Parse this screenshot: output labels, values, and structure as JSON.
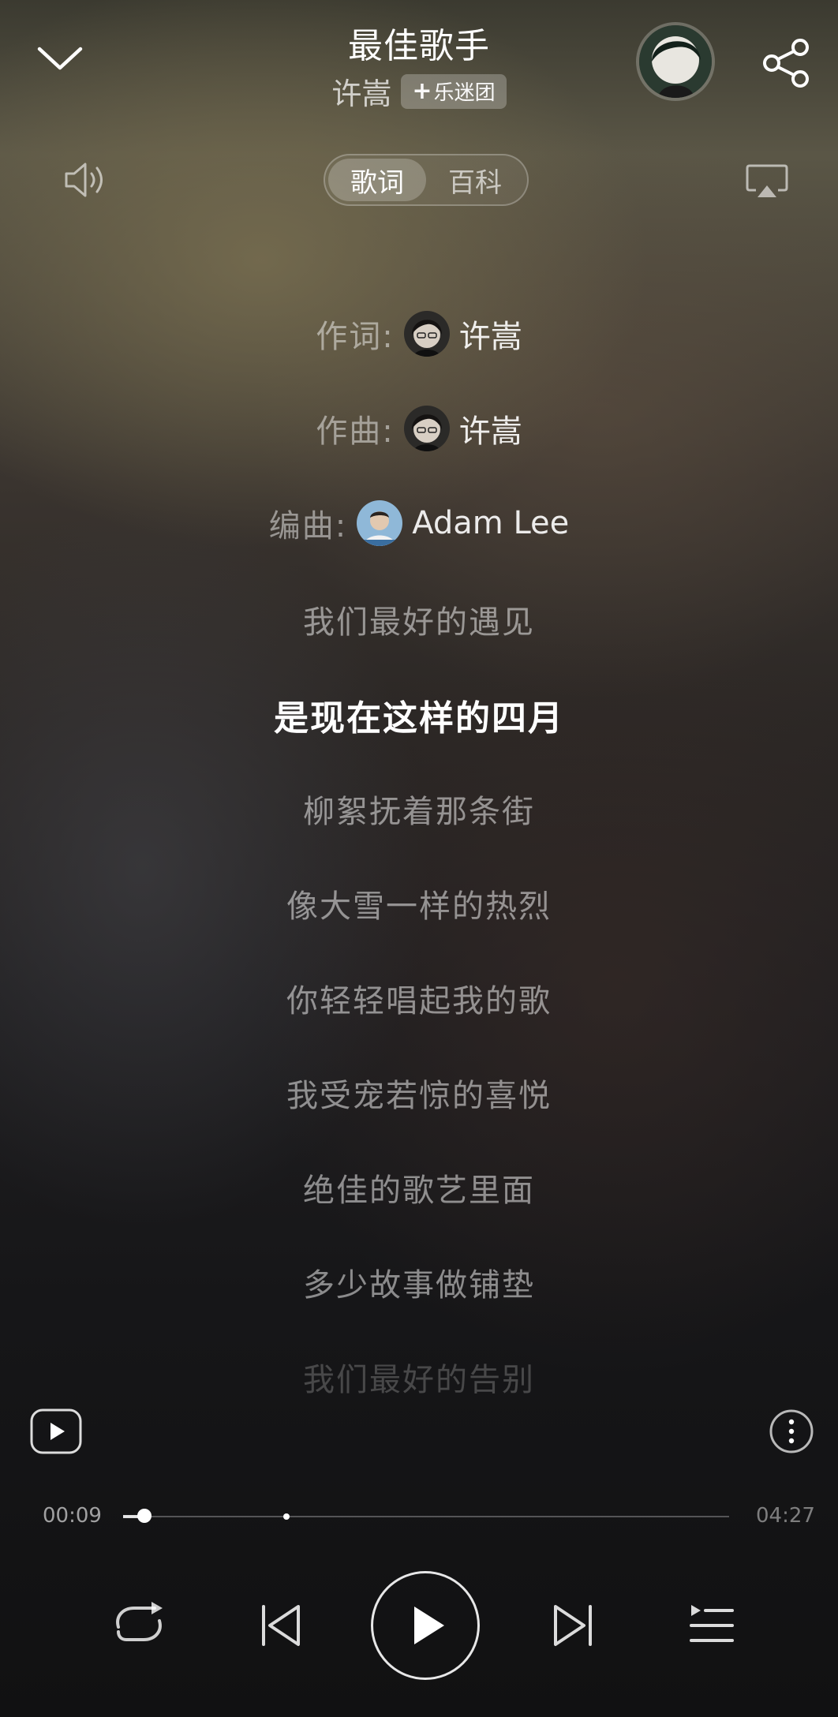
{
  "header": {
    "song_title": "最佳歌手",
    "artist": "许嵩",
    "fan_club_label": "乐迷团",
    "fan_club_prefix": "+"
  },
  "tabs": [
    {
      "label": "歌词",
      "active": true
    },
    {
      "label": "百科",
      "active": false
    }
  ],
  "credits": [
    {
      "label": "作词:",
      "name": "许嵩"
    },
    {
      "label": "作曲:",
      "name": "许嵩"
    },
    {
      "label": "编曲:",
      "name": "Adam Lee"
    }
  ],
  "lyrics": [
    "我们最好的遇见",
    "是现在这样的四月",
    "柳絮抚着那条街",
    "像大雪一样的热烈",
    "你轻轻唱起我的歌",
    "我受宠若惊的喜悦",
    "绝佳的歌艺里面",
    "多少故事做铺垫",
    "我们最好的告别"
  ],
  "current_lyric_index": 1,
  "player": {
    "current_time": "00:09",
    "total_time": "04:27",
    "progress_fraction": 0.035,
    "buffer_fraction": 0.27,
    "state": "paused"
  },
  "icons": {
    "collapse": "chevron-down-icon",
    "share": "share-icon",
    "volume": "volume-icon",
    "cast": "airplay-icon",
    "mv": "mv-play-icon",
    "more": "more-vertical-icon",
    "repeat": "repeat-icon",
    "prev": "previous-icon",
    "play": "play-icon",
    "next": "next-icon",
    "playlist": "playlist-icon"
  },
  "colors": {
    "text_primary": "#ffffff",
    "text_dim": "rgba(255,255,255,0.5)"
  }
}
